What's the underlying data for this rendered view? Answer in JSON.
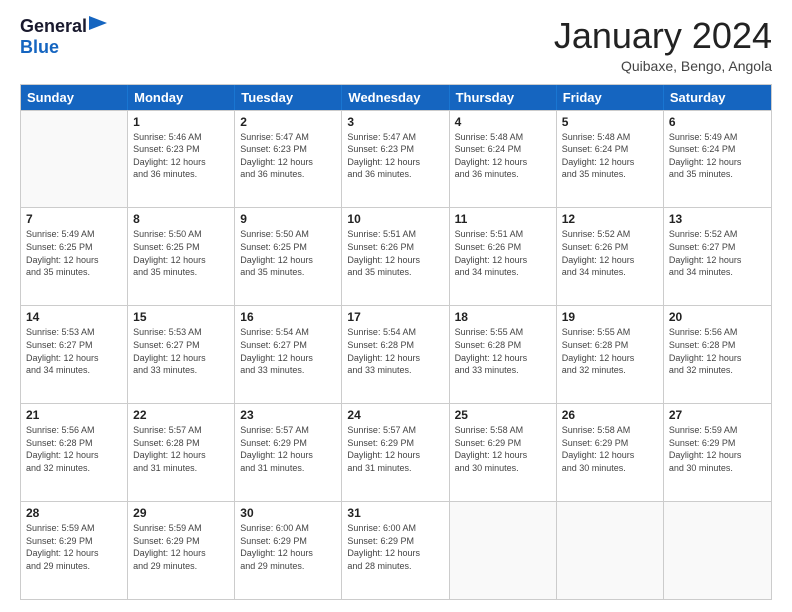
{
  "header": {
    "logo_line1": "General",
    "logo_line2": "Blue",
    "month_title": "January 2024",
    "location": "Quibaxe, Bengo, Angola"
  },
  "days_of_week": [
    "Sunday",
    "Monday",
    "Tuesday",
    "Wednesday",
    "Thursday",
    "Friday",
    "Saturday"
  ],
  "weeks": [
    [
      {
        "day": "",
        "info": ""
      },
      {
        "day": "1",
        "info": "Sunrise: 5:46 AM\nSunset: 6:23 PM\nDaylight: 12 hours\nand 36 minutes."
      },
      {
        "day": "2",
        "info": "Sunrise: 5:47 AM\nSunset: 6:23 PM\nDaylight: 12 hours\nand 36 minutes."
      },
      {
        "day": "3",
        "info": "Sunrise: 5:47 AM\nSunset: 6:23 PM\nDaylight: 12 hours\nand 36 minutes."
      },
      {
        "day": "4",
        "info": "Sunrise: 5:48 AM\nSunset: 6:24 PM\nDaylight: 12 hours\nand 36 minutes."
      },
      {
        "day": "5",
        "info": "Sunrise: 5:48 AM\nSunset: 6:24 PM\nDaylight: 12 hours\nand 35 minutes."
      },
      {
        "day": "6",
        "info": "Sunrise: 5:49 AM\nSunset: 6:24 PM\nDaylight: 12 hours\nand 35 minutes."
      }
    ],
    [
      {
        "day": "7",
        "info": "Sunrise: 5:49 AM\nSunset: 6:25 PM\nDaylight: 12 hours\nand 35 minutes."
      },
      {
        "day": "8",
        "info": "Sunrise: 5:50 AM\nSunset: 6:25 PM\nDaylight: 12 hours\nand 35 minutes."
      },
      {
        "day": "9",
        "info": "Sunrise: 5:50 AM\nSunset: 6:25 PM\nDaylight: 12 hours\nand 35 minutes."
      },
      {
        "day": "10",
        "info": "Sunrise: 5:51 AM\nSunset: 6:26 PM\nDaylight: 12 hours\nand 35 minutes."
      },
      {
        "day": "11",
        "info": "Sunrise: 5:51 AM\nSunset: 6:26 PM\nDaylight: 12 hours\nand 34 minutes."
      },
      {
        "day": "12",
        "info": "Sunrise: 5:52 AM\nSunset: 6:26 PM\nDaylight: 12 hours\nand 34 minutes."
      },
      {
        "day": "13",
        "info": "Sunrise: 5:52 AM\nSunset: 6:27 PM\nDaylight: 12 hours\nand 34 minutes."
      }
    ],
    [
      {
        "day": "14",
        "info": "Sunrise: 5:53 AM\nSunset: 6:27 PM\nDaylight: 12 hours\nand 34 minutes."
      },
      {
        "day": "15",
        "info": "Sunrise: 5:53 AM\nSunset: 6:27 PM\nDaylight: 12 hours\nand 33 minutes."
      },
      {
        "day": "16",
        "info": "Sunrise: 5:54 AM\nSunset: 6:27 PM\nDaylight: 12 hours\nand 33 minutes."
      },
      {
        "day": "17",
        "info": "Sunrise: 5:54 AM\nSunset: 6:28 PM\nDaylight: 12 hours\nand 33 minutes."
      },
      {
        "day": "18",
        "info": "Sunrise: 5:55 AM\nSunset: 6:28 PM\nDaylight: 12 hours\nand 33 minutes."
      },
      {
        "day": "19",
        "info": "Sunrise: 5:55 AM\nSunset: 6:28 PM\nDaylight: 12 hours\nand 32 minutes."
      },
      {
        "day": "20",
        "info": "Sunrise: 5:56 AM\nSunset: 6:28 PM\nDaylight: 12 hours\nand 32 minutes."
      }
    ],
    [
      {
        "day": "21",
        "info": "Sunrise: 5:56 AM\nSunset: 6:28 PM\nDaylight: 12 hours\nand 32 minutes."
      },
      {
        "day": "22",
        "info": "Sunrise: 5:57 AM\nSunset: 6:28 PM\nDaylight: 12 hours\nand 31 minutes."
      },
      {
        "day": "23",
        "info": "Sunrise: 5:57 AM\nSunset: 6:29 PM\nDaylight: 12 hours\nand 31 minutes."
      },
      {
        "day": "24",
        "info": "Sunrise: 5:57 AM\nSunset: 6:29 PM\nDaylight: 12 hours\nand 31 minutes."
      },
      {
        "day": "25",
        "info": "Sunrise: 5:58 AM\nSunset: 6:29 PM\nDaylight: 12 hours\nand 30 minutes."
      },
      {
        "day": "26",
        "info": "Sunrise: 5:58 AM\nSunset: 6:29 PM\nDaylight: 12 hours\nand 30 minutes."
      },
      {
        "day": "27",
        "info": "Sunrise: 5:59 AM\nSunset: 6:29 PM\nDaylight: 12 hours\nand 30 minutes."
      }
    ],
    [
      {
        "day": "28",
        "info": "Sunrise: 5:59 AM\nSunset: 6:29 PM\nDaylight: 12 hours\nand 29 minutes."
      },
      {
        "day": "29",
        "info": "Sunrise: 5:59 AM\nSunset: 6:29 PM\nDaylight: 12 hours\nand 29 minutes."
      },
      {
        "day": "30",
        "info": "Sunrise: 6:00 AM\nSunset: 6:29 PM\nDaylight: 12 hours\nand 29 minutes."
      },
      {
        "day": "31",
        "info": "Sunrise: 6:00 AM\nSunset: 6:29 PM\nDaylight: 12 hours\nand 28 minutes."
      },
      {
        "day": "",
        "info": ""
      },
      {
        "day": "",
        "info": ""
      },
      {
        "day": "",
        "info": ""
      }
    ]
  ]
}
